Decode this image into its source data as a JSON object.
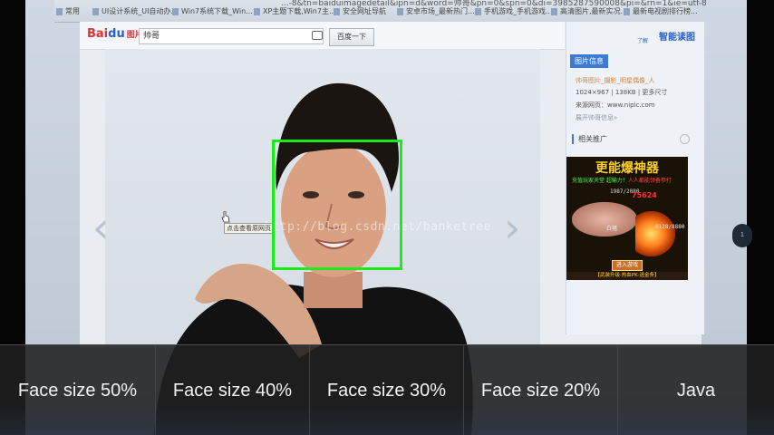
{
  "camera": {
    "options": [
      "Face size 50%",
      "Face size 40%",
      "Face size 30%",
      "Face size 20%",
      "Java"
    ]
  },
  "browser": {
    "url_tail": "...-8&tn=baiduimagedetail&ipn=d&word=帅哥&pn=0&spn=0&di=3985287590008&pi=&rn=1&ie=utf-8",
    "tabs": [
      "常用",
      "UI设计系统_UI自动办...",
      "Win7系统下载_Win...",
      "XP主题下载,Win7主...",
      "安全网址导航",
      "安卓市场_最新热门...",
      "手机游戏_手机游戏...",
      "高清图片,最新实况...",
      "最新电视剧排行榜..."
    ]
  },
  "baidu": {
    "logo_text": "Bai",
    "logo_paw": "du",
    "logo_sub": "图片",
    "search_value": "帅哥",
    "search_button": "百度一下"
  },
  "viewer": {
    "watermark": "http://blog.csdn.net/banketree",
    "tooltip": "点击查看原网页"
  },
  "panel": {
    "smart_label": "智能读图",
    "smart_small": "了解",
    "info_header": "图片信息",
    "info_title": "帅哥图片_摄影_明星偶像_人",
    "info_dims": "1024×967  |  138KB  |  更多尺寸",
    "info_source": "来源网页：www.nipic.com",
    "info_more": "展开帅哥信息»",
    "rec_header": "相关推广"
  },
  "ad": {
    "title": "更能爆神器",
    "line_green": "充值玩家天堂  超输力！",
    "line_red": "人人都能领备参打",
    "stats": "1987/2080",
    "number": "75624",
    "label_left": "白猪",
    "label_right": "0128/8880",
    "button": "进入游戏",
    "footer": "【武装升级·热血PK·送金条】"
  },
  "overlay": {
    "edge_button": "1"
  },
  "colors": {
    "face_box": "#1bea1b",
    "bar_background": "#202020",
    "bar_text": "#f2f2f2"
  }
}
